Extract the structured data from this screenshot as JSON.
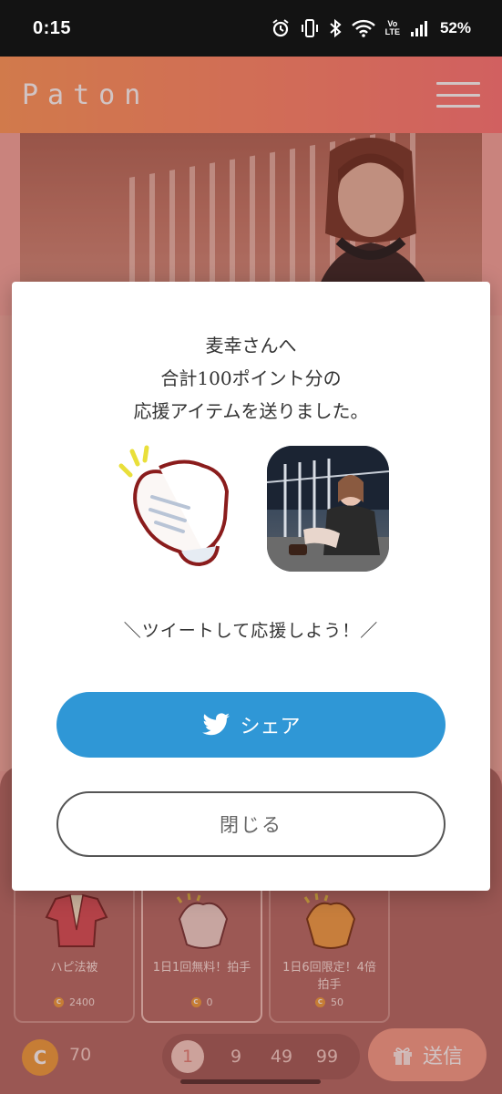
{
  "status_bar": {
    "time": "0:15",
    "volte": "Vo LTE",
    "battery": "52%",
    "icons": [
      "alarm-icon",
      "vibrate-icon",
      "bluetooth-icon",
      "wifi-icon",
      "volte-icon",
      "signal-icon"
    ]
  },
  "header": {
    "brand": "Paton",
    "menu_icon": "hamburger-menu-icon"
  },
  "modal": {
    "message_line1": "麦幸さんへ",
    "message_line2": "合計100ポイント分の",
    "message_line3": "応援アイテムを送りました。",
    "tweet_prompt": "＼ツイートして応援しよう！／",
    "share_label": "シェア",
    "close_label": "閉じる"
  },
  "items": [
    {
      "name": "ハピ法被",
      "price": "2400",
      "icon": "happi-coat-icon"
    },
    {
      "name": "1日1回無料！拍手",
      "price": "0",
      "icon": "clap-icon"
    },
    {
      "name": "1日6回限定！4倍拍手",
      "price": "50",
      "icon": "golden-clap-icon"
    }
  ],
  "footer": {
    "coin_symbol": "C",
    "coin_balance": "70",
    "quantities": [
      "1",
      "9",
      "49",
      "99"
    ],
    "selected_quantity": "1",
    "send_label": "送信"
  },
  "colors": {
    "header_gradient_start": "#ff9c5e",
    "header_gradient_end": "#ff7a7a",
    "share_button": "#2f97d6",
    "panel_bg": "#b66e69",
    "coin": "#f0a040"
  }
}
